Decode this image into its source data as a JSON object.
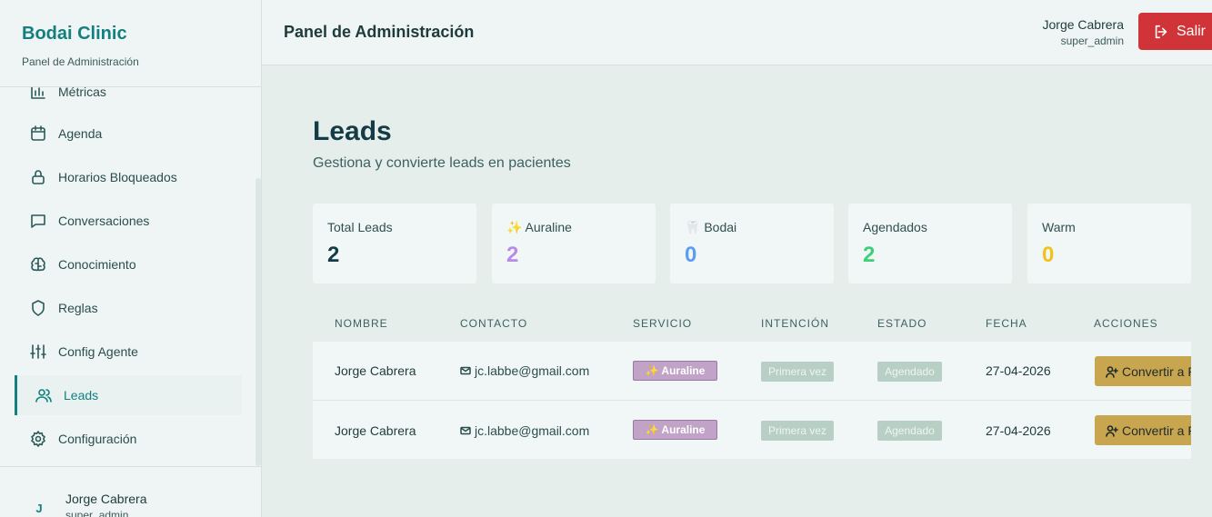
{
  "brand": {
    "title": "Bodai Clinic",
    "subtitle": "Panel de Administración"
  },
  "sidebar": {
    "items": [
      {
        "label": "Métricas",
        "icon": "bar-chart-icon"
      },
      {
        "label": "Agenda",
        "icon": "calendar-icon"
      },
      {
        "label": "Horarios Bloqueados",
        "icon": "lock-icon"
      },
      {
        "label": "Conversaciones",
        "icon": "message-square-icon"
      },
      {
        "label": "Conocimiento",
        "icon": "brain-icon"
      },
      {
        "label": "Reglas",
        "icon": "shield-icon"
      },
      {
        "label": "Config Agente",
        "icon": "sliders-icon"
      },
      {
        "label": "Leads",
        "icon": "users-icon",
        "active": true
      },
      {
        "label": "Configuración",
        "icon": "gear-icon"
      }
    ],
    "user": {
      "initial": "J",
      "name": "Jorge Cabrera",
      "role": "super_admin"
    }
  },
  "header": {
    "title": "Panel de Administración",
    "user_name": "Jorge Cabrera",
    "user_role": "super_admin",
    "logout_label": "Salir"
  },
  "main": {
    "title": "Leads",
    "subtitle": "Gestiona y convierte leads en pacientes",
    "stats": [
      {
        "label": "Total Leads",
        "value": "2",
        "color": "#143c46"
      },
      {
        "label": "✨ Auraline",
        "value": "2",
        "color": "#b98ae6"
      },
      {
        "label": "🦷 Bodai",
        "value": "0",
        "color": "#5b9ef0"
      },
      {
        "label": "Agendados",
        "value": "2",
        "color": "#3ecf78"
      },
      {
        "label": "Warm",
        "value": "0",
        "color": "#f2c21b"
      }
    ],
    "table": {
      "headers": [
        "NOMBRE",
        "CONTACTO",
        "SERVICIO",
        "INTENCIÓN",
        "ESTADO",
        "FECHA",
        "ACCIONES"
      ],
      "rows": [
        {
          "name": "Jorge Cabrera",
          "contact": "jc.labbe@gmail.com",
          "service": "✨ Auraline",
          "intent": "Primera vez",
          "status": "Agendado",
          "date": "27-04-2026",
          "action": "Convertir a Paciente"
        },
        {
          "name": "Jorge Cabrera",
          "contact": "jc.labbe@gmail.com",
          "service": "✨ Auraline",
          "intent": "Primera vez",
          "status": "Agendado",
          "date": "27-04-2026",
          "action": "Convertir a Paciente"
        }
      ]
    }
  }
}
